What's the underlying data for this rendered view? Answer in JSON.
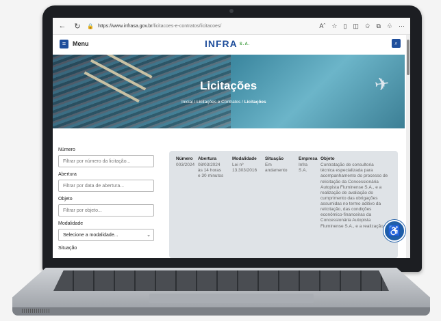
{
  "browser": {
    "url_prefix": "https://www.infrasa.gov.br",
    "url_path": "/licitacoes-e-contratos/licitacoes/",
    "reader_icon": "Aˆ",
    "icons": [
      "star-icon",
      "refresh-icon",
      "split-icon",
      "favorites-icon",
      "collections-icon",
      "extensions-icon",
      "more-icon"
    ]
  },
  "header": {
    "menu_label": "Menu",
    "logo_text": "INFRA",
    "logo_suffix": "S.A."
  },
  "hero": {
    "title": "Licitações",
    "breadcrumb_home": "Inicial",
    "breadcrumb_mid": "Licitações e Contratos",
    "breadcrumb_current": "Licitações"
  },
  "filters": {
    "numero_label": "Número",
    "numero_placeholder": "Filtrar por número da licitação...",
    "abertura_label": "Abertura",
    "abertura_placeholder": "Filtrar por data de abertura...",
    "objeto_label": "Objeto",
    "objeto_placeholder": "Filtrar por objeto...",
    "modalidade_label": "Modalidade",
    "modalidade_value": "Selecione a modalidade...",
    "situacao_label": "Situação"
  },
  "table": {
    "headers": {
      "numero": "Número",
      "abertura": "Abertura",
      "modalidade": "Modalidade",
      "situacao": "Situação",
      "empresa": "Empresa",
      "objeto": "Objeto"
    },
    "row": {
      "numero": "003/2024",
      "abertura": [
        "08/03/2024",
        "às 14 horas",
        "e 30 minutos"
      ],
      "modalidade": [
        "Lei nº",
        "13.303/2016"
      ],
      "situacao": [
        "Em",
        "andamento"
      ],
      "empresa": [
        "Infra",
        "S.A."
      ],
      "objeto": [
        "Contratação de consultoria",
        "técnica especializada para",
        "acompanhamento do processo de",
        "relicitação da Concessionária",
        "Autopista Fluminense S.A., e a",
        "realização de avaliação do",
        "cumprimento das obrigações",
        "assumidas no termo aditivo da",
        "relicitação, das condições",
        "econômico-financeiras da",
        "Concessionária Autopista",
        "Fluminense S.A., e a realização do"
      ]
    }
  }
}
